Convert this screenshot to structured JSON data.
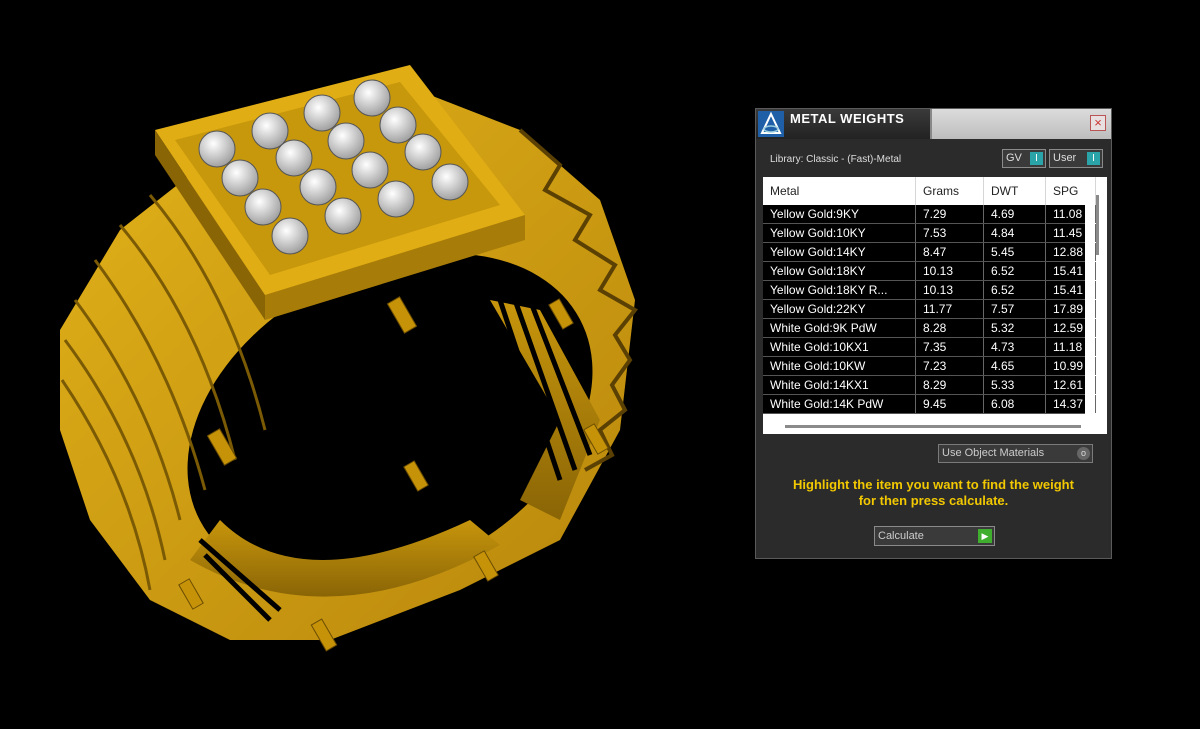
{
  "panel": {
    "title": "METAL WEIGHTS",
    "library": "Library: Classic - (Fast)-Metal",
    "gv_label": "GV",
    "user_label": "User",
    "close_glyph": "×",
    "columns": [
      "Metal",
      "Grams",
      "DWT",
      "SPG"
    ],
    "rows": [
      [
        "Yellow Gold:9KY",
        "7.29",
        "4.69",
        "11.08"
      ],
      [
        "Yellow Gold:10KY",
        "7.53",
        "4.84",
        "11.45"
      ],
      [
        "Yellow Gold:14KY",
        "8.47",
        "5.45",
        "12.88"
      ],
      [
        "Yellow Gold:18KY",
        "10.13",
        "6.52",
        "15.41"
      ],
      [
        "Yellow Gold:18KY R...",
        "10.13",
        "6.52",
        "15.41"
      ],
      [
        "Yellow Gold:22KY",
        "11.77",
        "7.57",
        "17.89"
      ],
      [
        "White Gold:9K PdW",
        "8.28",
        "5.32",
        "12.59"
      ],
      [
        "White Gold:10KX1",
        "7.35",
        "4.73",
        "11.18"
      ],
      [
        "White Gold:10KW",
        "7.23",
        "4.65",
        "10.99"
      ],
      [
        "White Gold:14KX1",
        "8.29",
        "5.33",
        "12.61"
      ],
      [
        "White Gold:14K PdW",
        "9.45",
        "6.08",
        "14.37"
      ]
    ],
    "use_object_materials": "Use Object Materials",
    "hint_line1": "Highlight the item you want to find the weight",
    "hint_line2": "for then press calculate.",
    "calculate_label": "Calculate"
  },
  "colors": {
    "gold": "#d4a20a",
    "hint_yellow": "#f2c800",
    "accent_teal": "#2aa4a8",
    "go_green": "#3fae2f"
  }
}
